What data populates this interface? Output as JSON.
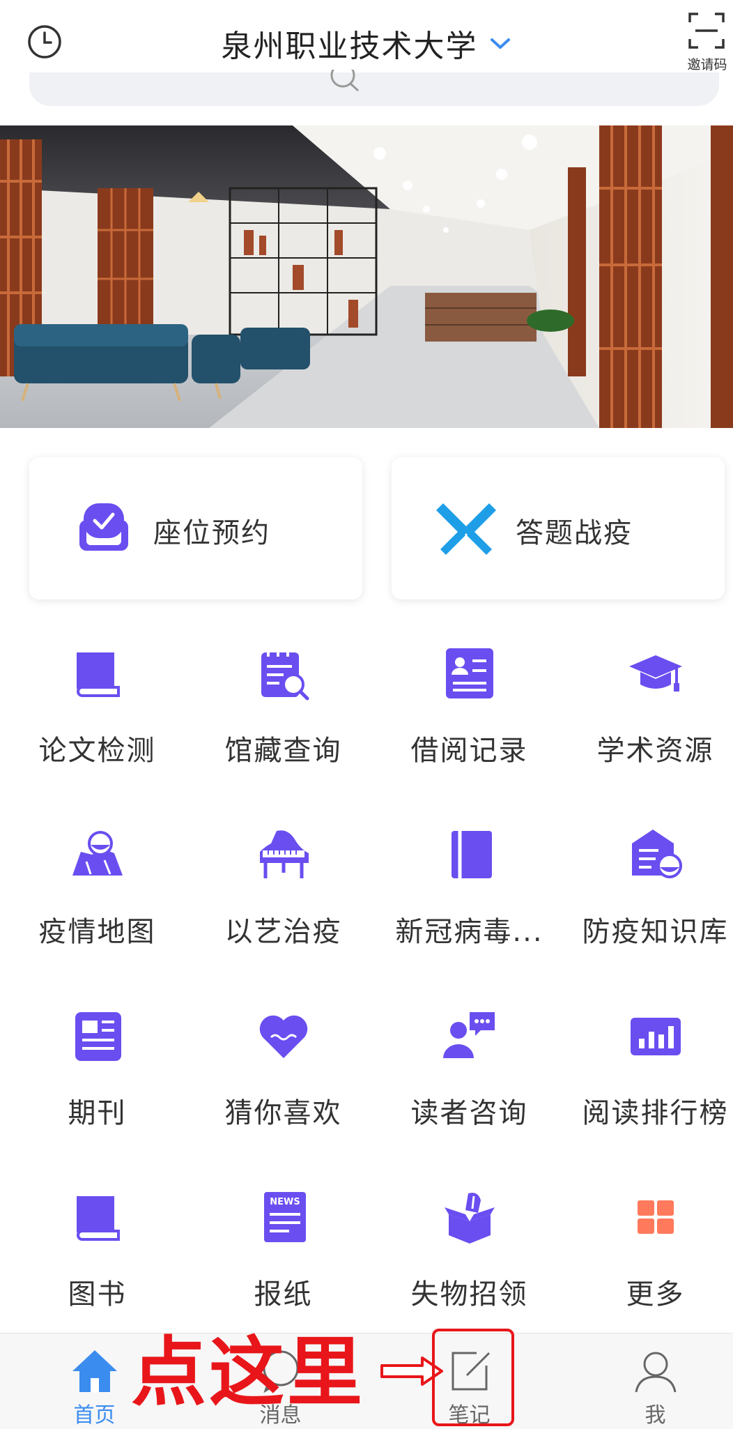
{
  "header": {
    "title": "泉州职业技术大学",
    "invite_label": "邀请码",
    "icons": {
      "history": "clock-icon",
      "switch": "chevron-down-icon",
      "scan": "scan-icon"
    },
    "accent": "#3b8cef"
  },
  "banner": {
    "image": "library-photo"
  },
  "features": [
    {
      "label": "座位预约",
      "icon": "seat-reservation-icon",
      "color": "#6a4ef0"
    },
    {
      "label": "答题战疫",
      "icon": "crossed-swords-icon",
      "color": "#1f9ee8"
    }
  ],
  "grid": [
    {
      "label": "论文检测",
      "icon": "book-icon"
    },
    {
      "label": "馆藏查询",
      "icon": "calendar-search-icon"
    },
    {
      "label": "借阅记录",
      "icon": "id-card-icon"
    },
    {
      "label": "学术资源",
      "icon": "graduation-cap-icon"
    },
    {
      "label": "疫情地图",
      "icon": "map-icon"
    },
    {
      "label": "以艺治疫",
      "icon": "piano-icon"
    },
    {
      "label": "新冠病毒...",
      "icon": "notebook-icon"
    },
    {
      "label": "防疫知识库",
      "icon": "knowledge-base-icon"
    },
    {
      "label": "期刊",
      "icon": "journal-icon"
    },
    {
      "label": "猜你喜欢",
      "icon": "heart-icon"
    },
    {
      "label": "读者咨询",
      "icon": "chat-user-icon"
    },
    {
      "label": "阅读排行榜",
      "icon": "bar-chart-icon"
    },
    {
      "label": "图书",
      "icon": "book-icon"
    },
    {
      "label": "报纸",
      "icon": "newspaper-icon"
    },
    {
      "label": "失物招领",
      "icon": "lost-found-box-icon"
    },
    {
      "label": "更多",
      "icon": "more-grid-icon"
    }
  ],
  "grid_icon_color": "#6a4ef0",
  "more_icon_color": "#ff7a5c",
  "nav": [
    {
      "label": "首页",
      "icon": "home-icon",
      "active": true
    },
    {
      "label": "消息",
      "icon": "message-icon",
      "active": false
    },
    {
      "label": "笔记",
      "icon": "note-edit-icon",
      "active": false
    },
    {
      "label": "我",
      "icon": "person-icon",
      "active": false
    }
  ],
  "annotation": {
    "text": "点这里",
    "color": "#e8161a"
  }
}
